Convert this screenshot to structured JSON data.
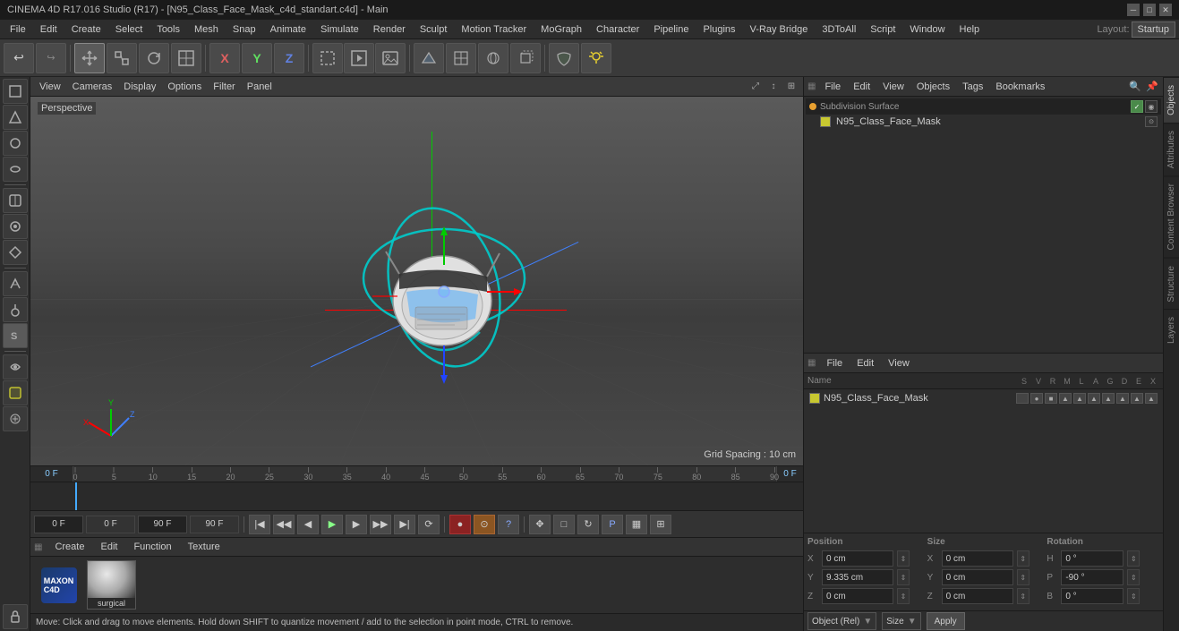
{
  "titlebar": {
    "title": "CINEMA 4D R17.016 Studio (R17) - [N95_Class_Face_Mask_c4d_standart.c4d] - Main"
  },
  "menu": {
    "items": [
      "File",
      "Edit",
      "Create",
      "Select",
      "Tools",
      "Mesh",
      "Snap",
      "Animate",
      "Simulate",
      "Render",
      "Sculpt",
      "Motion Tracker",
      "MoGraph",
      "Character",
      "Pipeline",
      "Plugins",
      "V-Ray Bridge",
      "3DToAll",
      "Script",
      "Window",
      "Help"
    ]
  },
  "toolbar": {
    "undo_icon": "↩",
    "redo_icon": "↪",
    "move_icon": "✥",
    "scale_icon": "⤡",
    "rotate_icon": "↻",
    "transform_icon": "⊞",
    "x_icon": "X",
    "y_icon": "Y",
    "z_icon": "Z",
    "xyz_icon": "XYZ",
    "layout_label": "Layout:",
    "layout_value": "Startup"
  },
  "viewport": {
    "label": "Perspective",
    "view_menu": "View",
    "cameras_menu": "Cameras",
    "display_menu": "Display",
    "options_menu": "Options",
    "filter_menu": "Filter",
    "panel_menu": "Panel",
    "grid_spacing": "Grid Spacing : 10 cm"
  },
  "timeline": {
    "marks": [
      "0",
      "5",
      "10",
      "15",
      "20",
      "25",
      "30",
      "35",
      "40",
      "45",
      "50",
      "55",
      "60",
      "65",
      "70",
      "75",
      "80",
      "85",
      "90"
    ],
    "current_frame": "0 F",
    "start_frame": "0 F",
    "end_frame": "90 F",
    "preview_end": "90 F"
  },
  "transport": {
    "current_frame_field": "0 F",
    "start_field": "0 F",
    "end_field": "90 F",
    "preview_field": "90 F",
    "record_btn": "●",
    "record_auto_btn": "⊙",
    "record_help_btn": "?",
    "prev_key_btn": "|◀",
    "prev_frame_btn": "◀",
    "play_btn": "▶",
    "next_frame_btn": "▶|",
    "next_key_btn": "▶▶",
    "loop_btn": "⟳"
  },
  "material_panel": {
    "toolbar": {
      "create_btn": "Create",
      "edit_btn": "Edit",
      "function_btn": "Function",
      "texture_btn": "Texture"
    },
    "materials": [
      {
        "name": "surgical",
        "color": "#888"
      }
    ]
  },
  "status_bar": {
    "text": "Move: Click and drag to move elements. Hold down SHIFT to quantize movement / add to the selection in point mode, CTRL to remove."
  },
  "scene_panel": {
    "toolbar": {
      "file_btn": "File",
      "edit_btn": "Edit",
      "view_btn": "View",
      "objects_btn": "Objects",
      "tags_btn": "Tags",
      "bookmarks_btn": "Bookmarks"
    },
    "items": [
      {
        "name": "Subdivision Surface",
        "type": "subdiv",
        "color": "#e8a030",
        "active": true
      },
      {
        "name": "N95_Class_Face_Mask",
        "type": "mesh",
        "color": "#c8c830",
        "indent": 1
      }
    ]
  },
  "objects_panel": {
    "toolbar": {
      "file_btn": "File",
      "edit_btn": "Edit",
      "view_btn": "View"
    },
    "columns": {
      "name": "Name",
      "icons": [
        "S",
        "V",
        "R",
        "M",
        "L",
        "A",
        "G",
        "D",
        "E",
        "X"
      ]
    },
    "rows": [
      {
        "name": "N95_Class_Face_Mask",
        "color": "#c8c830",
        "icons": [
          "",
          "●",
          "■",
          "▲",
          "▲",
          "▲",
          "▲",
          "▲",
          "▲",
          "▲",
          "▲"
        ]
      }
    ]
  },
  "properties": {
    "position_label": "Position",
    "size_label": "Size",
    "rotation_label": "Rotation",
    "px": "0 cm",
    "py": "9.335 cm",
    "pz": "0 cm",
    "sx": "0 cm",
    "sy": "0 cm",
    "sz": "0 cm",
    "rh": "0 °",
    "rp": "-90 °",
    "rb": "0 °",
    "coord_system": "Object (Rel)",
    "size_system": "Size",
    "apply_btn": "Apply"
  },
  "right_tabs": [
    "Objects",
    "Attributes"
  ],
  "side_tabs": [
    "Content Browser",
    "Structure",
    "Layers"
  ],
  "icons": {
    "cube": "□",
    "sphere": "○",
    "cylinder": "⬭",
    "cone": "△",
    "camera": "📷",
    "light": "💡",
    "nurbs": "⌓",
    "deformer": "⤢",
    "paint": "🖌",
    "script": "📜",
    "texture": "▦",
    "lock": "🔒"
  }
}
